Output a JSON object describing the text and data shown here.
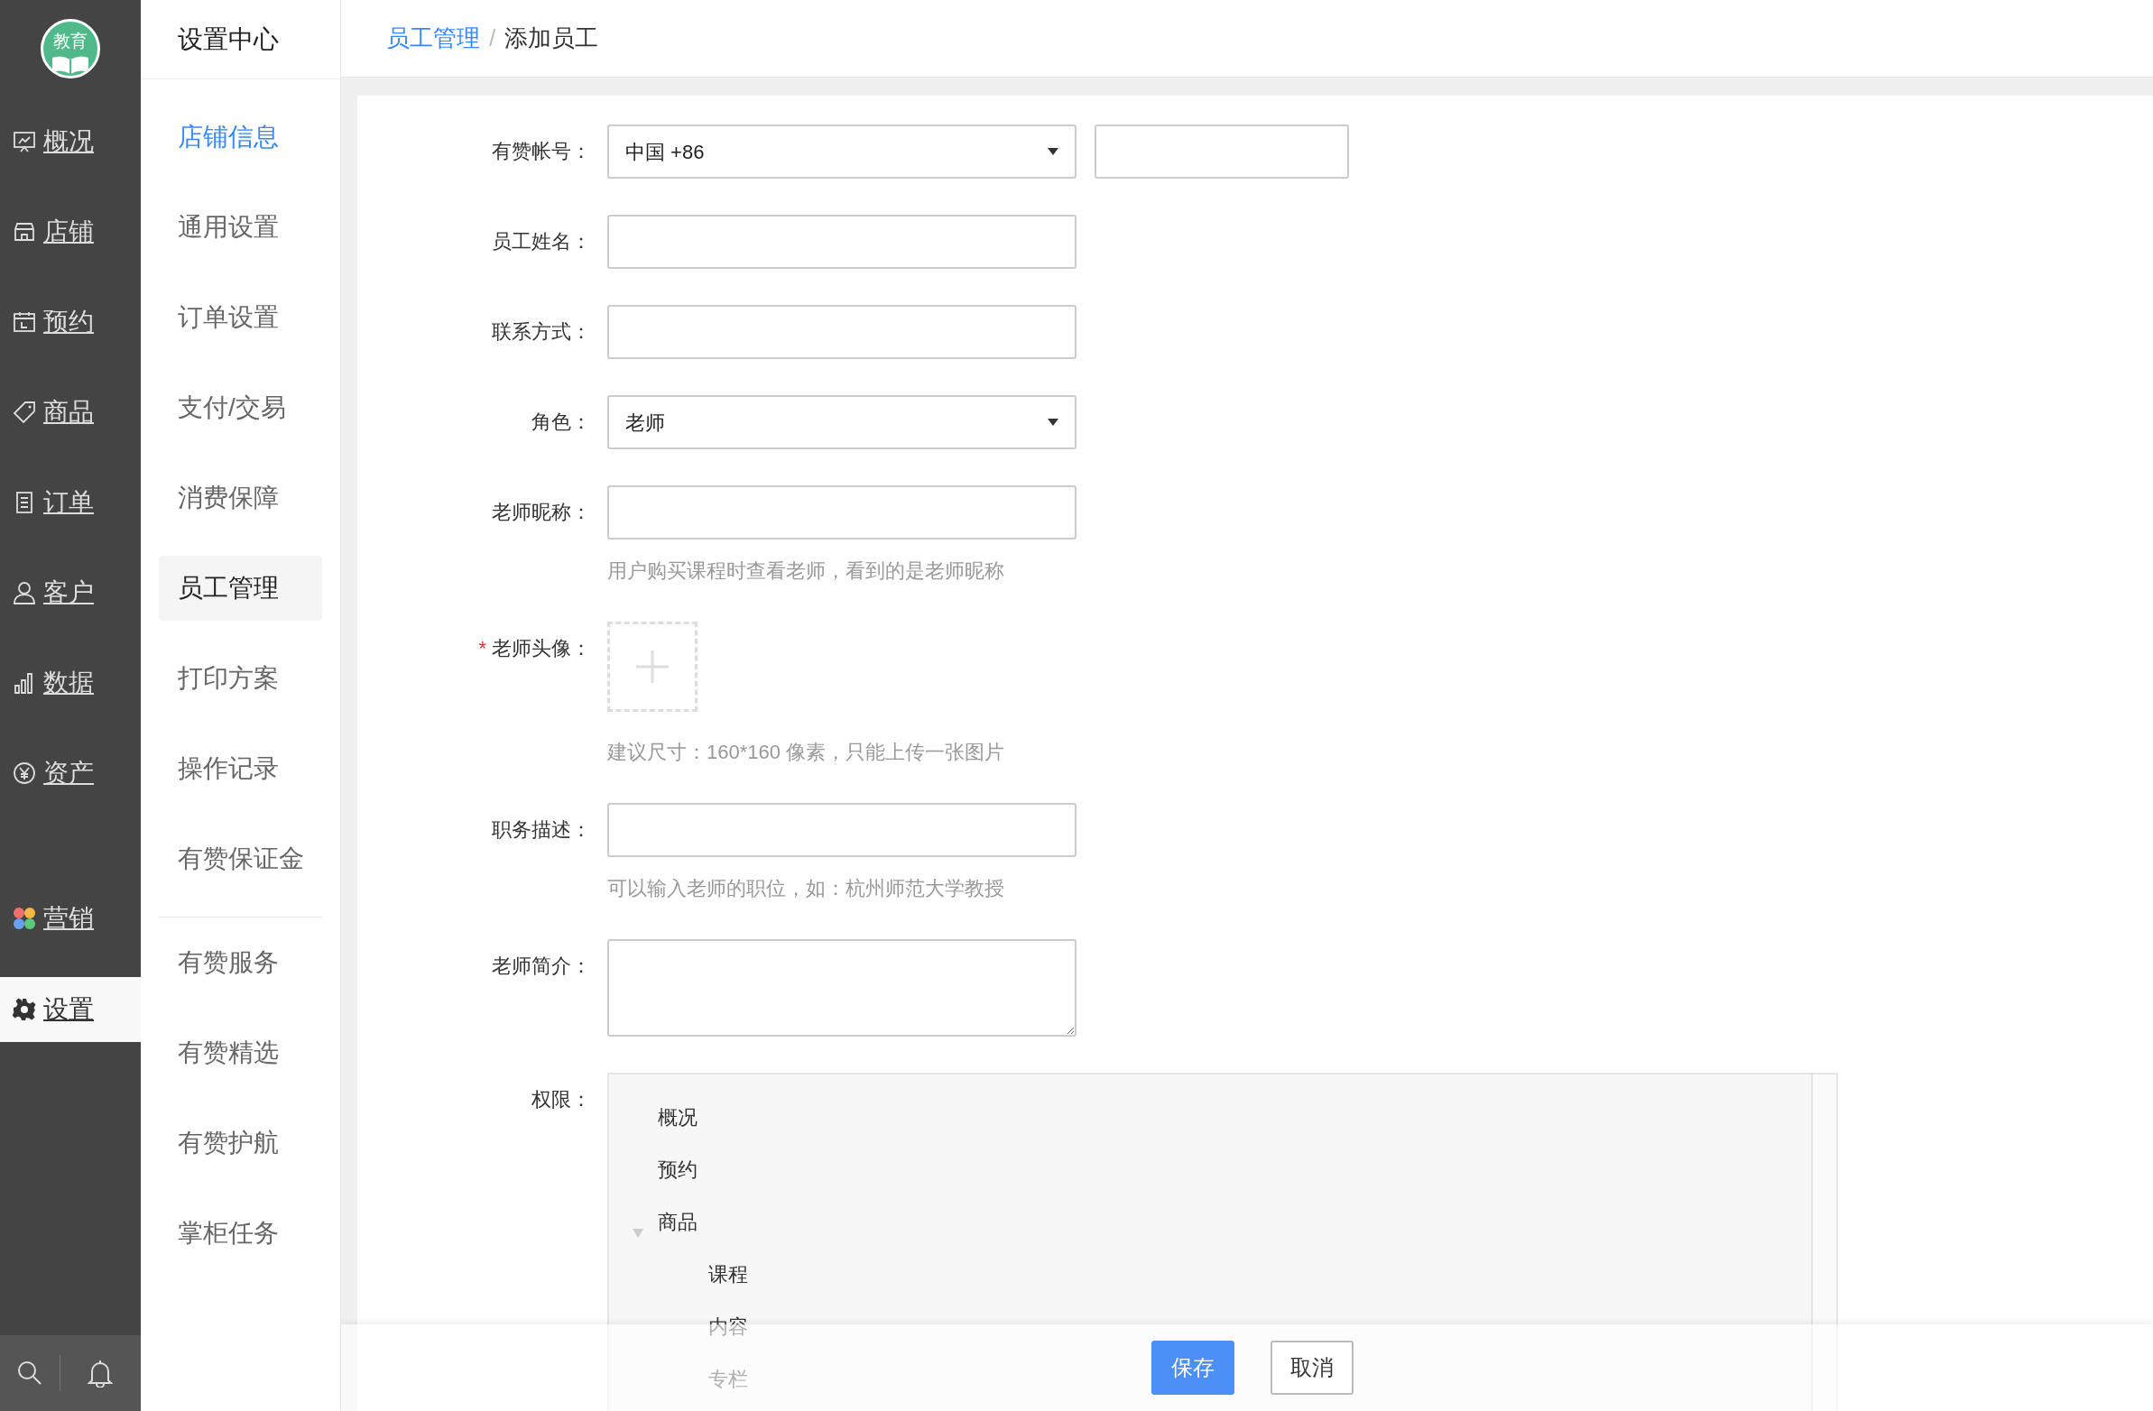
{
  "sidebar": {
    "logo_text": "教育",
    "items": [
      {
        "label": "概况",
        "selected": false
      },
      {
        "label": "店铺",
        "selected": false
      },
      {
        "label": "预约",
        "selected": false
      },
      {
        "label": "商品",
        "selected": false
      },
      {
        "label": "订单",
        "selected": false
      },
      {
        "label": "客户",
        "selected": false
      },
      {
        "label": "数据",
        "selected": false
      },
      {
        "label": "资产",
        "selected": false
      },
      {
        "label": "营销",
        "selected": false
      },
      {
        "label": "设置",
        "selected": true
      }
    ]
  },
  "subnav": {
    "title": "设置中心",
    "groups": [
      [
        {
          "label": "店铺信息",
          "selected": false,
          "highlighted": true
        },
        {
          "label": "通用设置",
          "selected": false,
          "highlighted": false
        },
        {
          "label": "订单设置",
          "selected": false,
          "highlighted": false
        },
        {
          "label": "支付/交易",
          "selected": false,
          "highlighted": false
        },
        {
          "label": "消费保障",
          "selected": false,
          "highlighted": false
        },
        {
          "label": "员工管理",
          "selected": true,
          "highlighted": false
        },
        {
          "label": "打印方案",
          "selected": false,
          "highlighted": false
        },
        {
          "label": "操作记录",
          "selected": false,
          "highlighted": false
        },
        {
          "label": "有赞保证金",
          "selected": false,
          "highlighted": false
        }
      ],
      [
        {
          "label": "有赞服务",
          "selected": false,
          "highlighted": false
        },
        {
          "label": "有赞精选",
          "selected": false,
          "highlighted": false
        },
        {
          "label": "有赞护航",
          "selected": false,
          "highlighted": false
        },
        {
          "label": "掌柜任务",
          "selected": false,
          "highlighted": false
        }
      ]
    ]
  },
  "breadcrumb": [
    {
      "kind": "link",
      "label": "员工管理"
    },
    {
      "kind": "separator",
      "label": "/"
    },
    {
      "kind": "current",
      "label": "添加员工"
    }
  ],
  "form": [
    {
      "kind": "select",
      "label": "有赞帐号：",
      "value": "中国 +86",
      "extra_input": true
    },
    {
      "kind": "input",
      "label": "员工姓名："
    },
    {
      "kind": "input",
      "label": "联系方式："
    },
    {
      "kind": "select",
      "label": "角色：",
      "value": "老师"
    },
    {
      "kind": "input",
      "label": "老师昵称：",
      "help": "用户购买课程时查看老师，看到的是老师昵称"
    },
    {
      "kind": "upload",
      "label": "老师头像：",
      "required_mark": "*",
      "help": "建议尺寸：160*160 像素，只能上传一张图片"
    },
    {
      "kind": "input",
      "label": "职务描述：",
      "help": "可以输入老师的职位，如：杭州师范大学教授"
    },
    {
      "kind": "textarea",
      "label": "老师简介："
    },
    {
      "kind": "tree",
      "label": "权限：",
      "tree": [
        {
          "label": "概况"
        },
        {
          "label": "预约"
        },
        {
          "label": "商品",
          "expanded": true,
          "children": [
            {
              "label": "课程"
            },
            {
              "label": "内容"
            },
            {
              "label": "专栏"
            }
          ]
        }
      ]
    }
  ],
  "footer": {
    "buttons": [
      {
        "label": "保存",
        "primary": true
      },
      {
        "label": "取消",
        "primary": false
      }
    ]
  }
}
